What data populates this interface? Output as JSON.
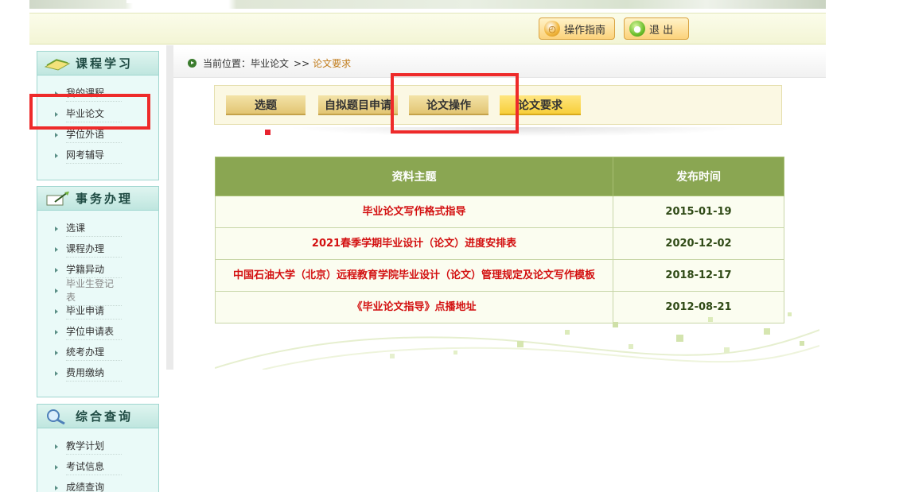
{
  "header": {
    "guide_label": "操作指南",
    "exit_label": "退 出"
  },
  "sidebar": {
    "course": {
      "title": "课程学习",
      "items": [
        {
          "label": "我的课程"
        },
        {
          "label": "毕业论文"
        },
        {
          "label": "学位外语"
        },
        {
          "label": "网考辅导"
        }
      ]
    },
    "affairs": {
      "title": "事务办理",
      "items": [
        {
          "label": "选课"
        },
        {
          "label": "课程办理"
        },
        {
          "label": "学籍异动"
        },
        {
          "label": "毕业生登记表"
        },
        {
          "label": "毕业申请"
        },
        {
          "label": "学位申请表"
        },
        {
          "label": "统考办理"
        },
        {
          "label": "费用缴纳"
        }
      ]
    },
    "query": {
      "title": "综合查询",
      "items": [
        {
          "label": "教学计划"
        },
        {
          "label": "考试信息"
        },
        {
          "label": "成绩查询"
        }
      ]
    }
  },
  "breadcrumb": {
    "prefix": "当前位置：",
    "parent": "毕业论文",
    "separator": ">>",
    "current": "论文要求"
  },
  "tabs": [
    {
      "label": "选题"
    },
    {
      "label": "自拟题目申请"
    },
    {
      "label": "论文操作"
    },
    {
      "label": "论文要求"
    }
  ],
  "table": {
    "headers": [
      "资料主题",
      "发布时间"
    ],
    "rows": [
      {
        "topic": "毕业论文写作格式指导",
        "date": "2015-01-19"
      },
      {
        "topic": "2021春季学期毕业设计（论文）进度安排表",
        "date": "2020-12-02"
      },
      {
        "topic": "中国石油大学（北京）远程教育学院毕业设计（论文）管理规定及论文写作模板",
        "date": "2018-12-17"
      },
      {
        "topic": "《毕业论文指导》点播地址",
        "date": "2012-08-21"
      }
    ]
  },
  "colors": {
    "table_header": "#8aa652",
    "topic_text": "#d31010",
    "annotation": "#ee2a2a"
  }
}
